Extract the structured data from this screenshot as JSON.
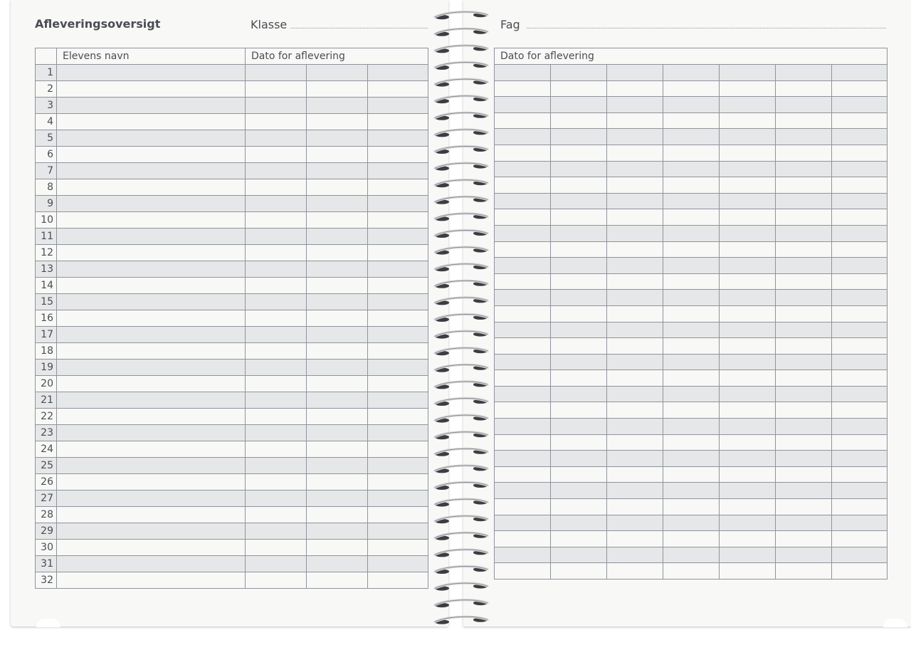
{
  "left_page": {
    "title": "Afleveringsoversigt",
    "class_label": "Klasse",
    "table": {
      "headers": [
        "",
        "Elevens navn",
        "Dato for aflevering"
      ],
      "row_numbers": [
        "1",
        "2",
        "3",
        "4",
        "5",
        "6",
        "7",
        "8",
        "9",
        "10",
        "11",
        "12",
        "13",
        "14",
        "15",
        "16",
        "17",
        "18",
        "19",
        "20",
        "21",
        "22",
        "23",
        "24",
        "25",
        "26",
        "27",
        "28",
        "29",
        "30",
        "31",
        "32"
      ]
    }
  },
  "right_page": {
    "subject_label": "Fag",
    "table": {
      "header": "Dato for aflevering"
    }
  },
  "colors": {
    "shaded_row": "#e6e7e8",
    "grid_line": "#8f939b",
    "paper": "#f8f8f6",
    "text": "#4a4d52"
  }
}
